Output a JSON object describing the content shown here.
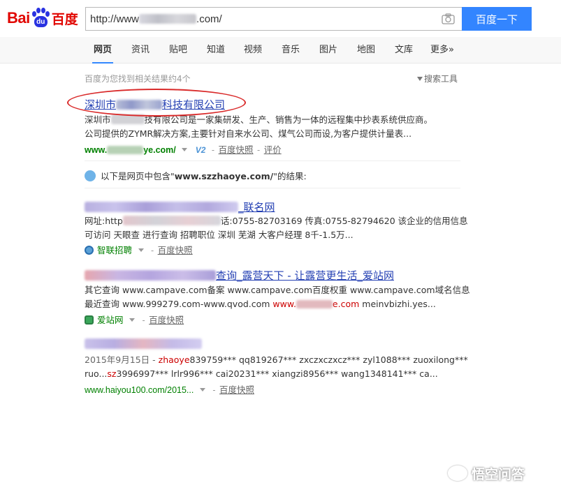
{
  "header": {
    "logo_bai": "Bai",
    "logo_du": "du",
    "logo_cn": "百度",
    "search_value": "http://www.[redacted].com/",
    "search_visible_prefix": "http://www",
    "search_visible_suffix": ".com/",
    "search_button": "百度一下"
  },
  "nav": {
    "items": [
      "网页",
      "资讯",
      "贴吧",
      "知道",
      "视频",
      "音乐",
      "图片",
      "地图",
      "文库",
      "更多»"
    ],
    "active_index": 0
  },
  "results_meta": {
    "count_text": "百度为您找到相关结果约4个",
    "search_tools": "搜索工具"
  },
  "results": [
    {
      "title_prefix": "深圳市",
      "title_suffix": "科技有限公司",
      "abstract_line1_prefix": "深圳市",
      "abstract_line1_suffix": "技有限公司是一家集研发、生产、销售为一体的远程集中抄表系统供应商。",
      "abstract_line2": "公司提供的ZYMR解决方案,主要针对自来水公司、煤气公司而设,为客户提供计量表...",
      "url_prefix": "www.",
      "url_suffix": "ye.com/",
      "badge": "V2",
      "snapshot": "百度快照",
      "review": "评价"
    },
    {
      "title_suffix": "_联名网",
      "abstract_line1_prefix": "网址:http",
      "abstract_line1_suffix": "话:0755-82703169 传真:0755-82794620 该企业的信用信息",
      "abstract_line2": "可访问 天眼查 进行查询 招聘职位 深圳 芜湖 大客户经理 8千-1.5万...",
      "source": "智联招聘",
      "snapshot": "百度快照"
    },
    {
      "title_suffix": "查询_露营天下 - 让露营更生活_爱站网",
      "abstract_line1": "其它查询 www.campave.com备案 www.campave.com百度权重 www.campave.com域名信息",
      "abstract_line2_prefix": "最近查询 www.999279.com-www.qvod.com ",
      "abstract_line2_red_prefix": "www.",
      "abstract_line2_red_suffix": "e.com",
      "abstract_line2_suffix": " meinvbizhi.yes...",
      "source": "爱站网",
      "snapshot": "百度快照"
    },
    {
      "abstract_line1_prefix": "2015年9月15日 - ",
      "abstract_line1_red": "zhaoye",
      "abstract_line1_suffix": "839759*** qq819267*** zxczxczxcz*** zyl1088*** zuoxilong***",
      "abstract_line2_prefix": "ruo...",
      "abstract_line2_red": "sz",
      "abstract_line2_suffix": "3996997*** lrlr996*** cai20231*** xiangzi8956*** wang1348141*** ca...",
      "url": "www.haiyou100.com/2015...",
      "snapshot": "百度快照"
    }
  ],
  "notice": {
    "prefix": "以下是网页中包含\"",
    "bold": "www.szzhaoye.com/",
    "suffix": "\"的结果:"
  },
  "watermark": "悟空问答",
  "colors": {
    "brand_red": "#e10601",
    "brand_blue": "#2932e1",
    "button_blue": "#3385ff",
    "link_blue": "#2440b3",
    "url_green": "#008000",
    "annotation_red": "#d92a2a"
  }
}
